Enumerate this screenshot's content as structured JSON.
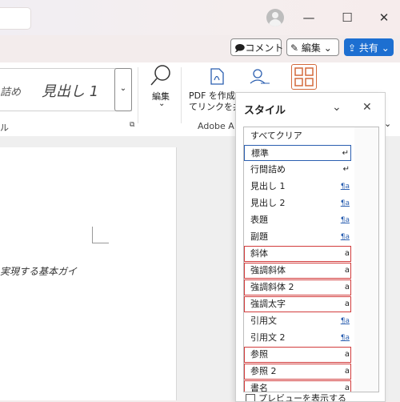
{
  "titlebar": {
    "window_controls": [
      "minimize-icon",
      "maximize-icon",
      "close-icon"
    ]
  },
  "toolbar": {
    "comment_label": "コメント",
    "edit_label": "編集",
    "share_label": "共有"
  },
  "ribbon": {
    "style_left_fragment": "詰め",
    "style_heading": "見出し 1",
    "find_label": "編集",
    "pdf_label_line1": "PDF を作成",
    "pdf_label_line2": "てリンクを共有",
    "styles_group_label": "ル",
    "adobe_group_label": "Adobe A"
  },
  "document": {
    "visible_text": "実現する基本ガイ"
  },
  "styles_pane": {
    "title": "スタイル",
    "items": [
      {
        "label": "すべてクリア",
        "mark": ""
      },
      {
        "label": "標準",
        "mark": "↵"
      },
      {
        "label": "行間詰め",
        "mark": "↵"
      },
      {
        "label": "見出し 1",
        "mark": "¶a"
      },
      {
        "label": "見出し 2",
        "mark": "¶a"
      },
      {
        "label": "表題",
        "mark": "¶a"
      },
      {
        "label": "副題",
        "mark": "¶a"
      },
      {
        "label": "斜体",
        "mark": "a"
      },
      {
        "label": "強調斜体",
        "mark": "a"
      },
      {
        "label": "強調斜体 2",
        "mark": "a"
      },
      {
        "label": "強調太字",
        "mark": "a"
      },
      {
        "label": "引用文",
        "mark": "¶a"
      },
      {
        "label": "引用文 2",
        "mark": "¶a"
      },
      {
        "label": "参照",
        "mark": "a"
      },
      {
        "label": "参照 2",
        "mark": "a"
      },
      {
        "label": "書名",
        "mark": "a"
      }
    ],
    "preview_label": "プレビューを表示する"
  },
  "colors": {
    "accent": "#1d6fd1",
    "highlight": "#d23c3c"
  }
}
